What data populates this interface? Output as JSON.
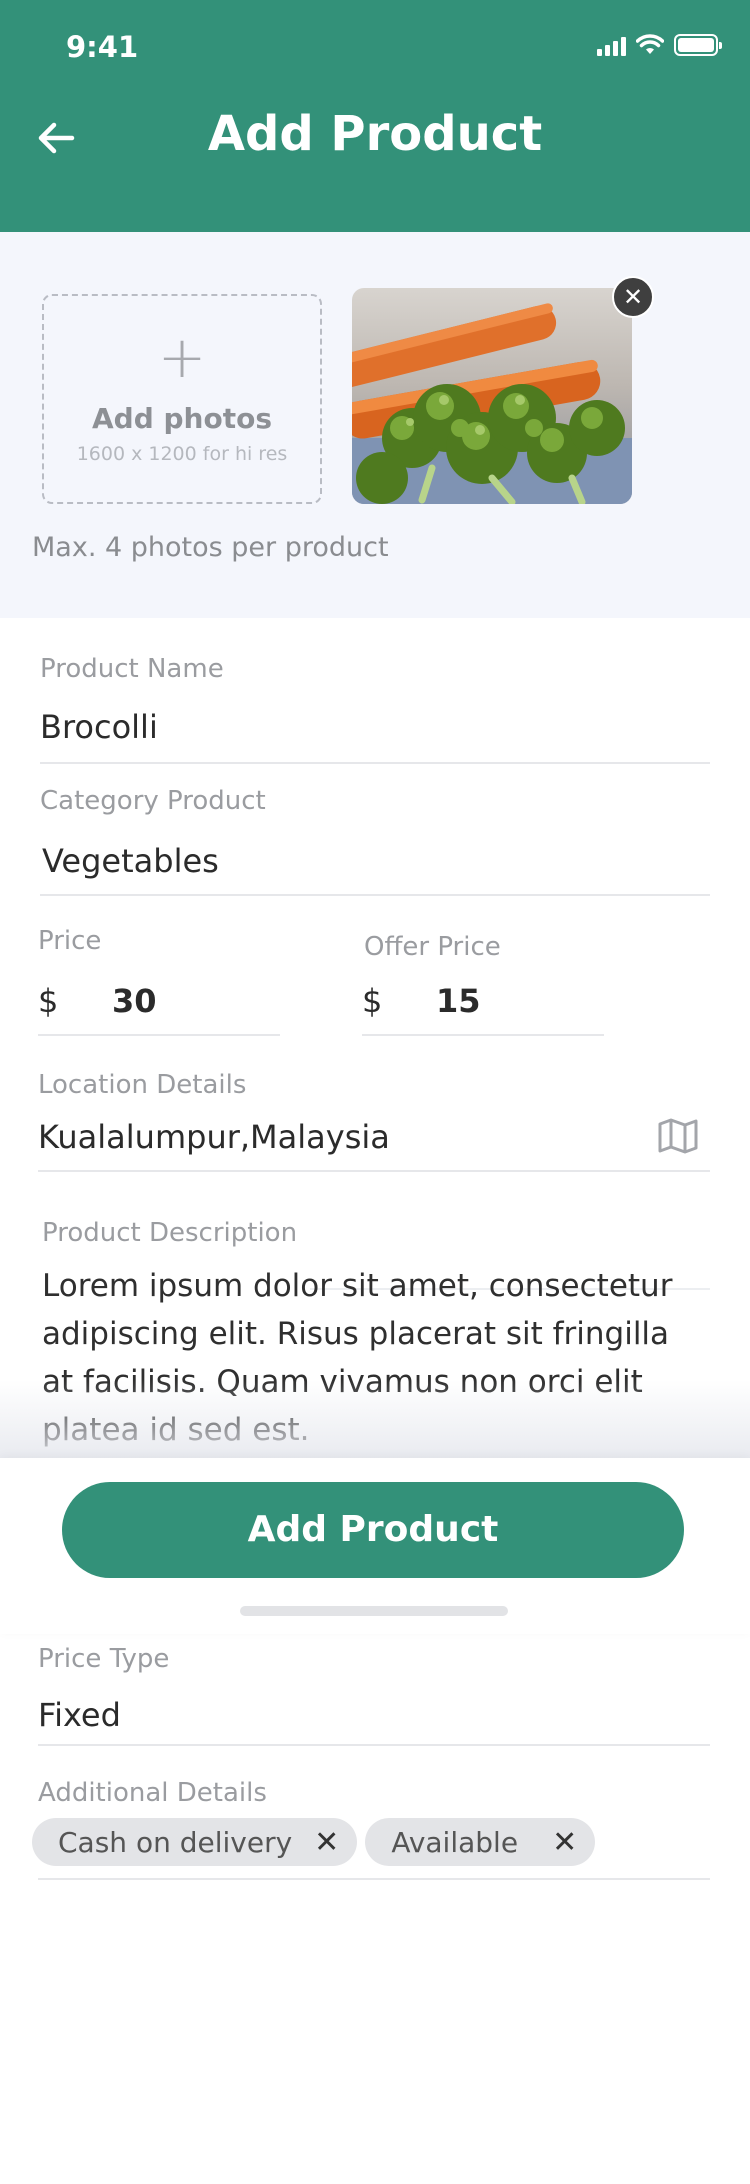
{
  "status_bar": {
    "time": "9:41"
  },
  "header": {
    "title": "Add Product",
    "back_icon": "arrow-left-icon"
  },
  "photos": {
    "add_label": "Add photos",
    "add_hint": "1600 x 1200 for hi res",
    "hint": "Max. 4 photos per product",
    "remove_icon": "close-icon"
  },
  "form": {
    "product_name": {
      "label": "Product Name",
      "value": "Brocolli"
    },
    "category": {
      "label": "Category Product",
      "value": "Vegetables"
    },
    "price": {
      "label": "Price",
      "currency": "$",
      "value": "30"
    },
    "offer_price": {
      "label": "Offer Price",
      "currency": "$",
      "value": "15"
    },
    "location": {
      "label": "Location Details",
      "value": "Kualalumpur,Malaysia",
      "icon": "map-icon"
    },
    "description": {
      "label": "Product Description",
      "value": "Lorem ipsum dolor sit amet, consectetur adipiscing elit. Risus placerat sit fringilla at facilisis. Quam vivamus non orci elit platea id sed est."
    },
    "price_type": {
      "label": "Price Type",
      "value": "Fixed"
    },
    "additional": {
      "label": "Additional Details",
      "chips": [
        "Cash on delivery",
        "Available"
      ]
    }
  },
  "footer": {
    "button_label": "Add Product"
  },
  "colors": {
    "primary": "#339179",
    "background_light": "#f4f6fc"
  }
}
